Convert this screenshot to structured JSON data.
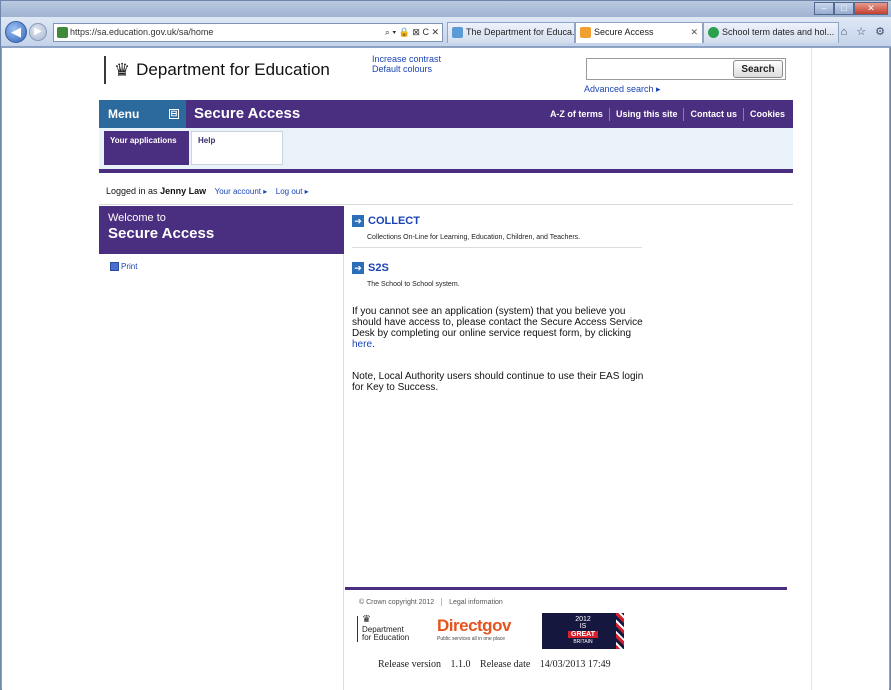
{
  "browser": {
    "address": "https://sa.education.gov.uk/sa/home",
    "address_controls": "⌕ ▾ 🔒 ⊠ C ✕",
    "tabs": [
      {
        "label": "The Department for Educa...",
        "close": "✕"
      },
      {
        "label": "Secure Access",
        "close": "✕"
      },
      {
        "label": "School term dates and hol...",
        "close": ""
      }
    ],
    "toolbar_icons": "⌂ ☆ ⚙"
  },
  "header": {
    "department": "Department for Education",
    "crest": "♛",
    "increase_contrast": "Increase contrast",
    "default_colours": "Default colours",
    "search_button": "Search",
    "search_value": "",
    "advanced_search": "Advanced search ▸"
  },
  "navbar": {
    "menu": "Menu",
    "menu_toggle": "⊟",
    "section_title": "Secure Access",
    "links": [
      "A-Z of terms",
      "Using this site",
      "Contact us",
      "Cookies"
    ]
  },
  "tabs": {
    "your_applications": "Your applications",
    "help": "Help"
  },
  "login": {
    "prefix": "Logged in as",
    "user": "Jenny Law",
    "account": "Your account ▸",
    "logout": "Log out ▸"
  },
  "sidebar": {
    "welcome_line1": "Welcome to",
    "welcome_line2": "Secure Access",
    "print": "Print"
  },
  "apps": [
    {
      "name": "COLLECT",
      "description": "Collections On-Line for Learning, Education, Children, and Teachers."
    },
    {
      "name": "S2S",
      "description": "The School to School system."
    }
  ],
  "content": {
    "para1": "If you cannot see an application (system) that you believe you should have access to, please contact the Secure Access Service Desk by completing our online service request form, by clicking ",
    "para1_link": "here",
    "para1_end": ".",
    "para2": "Note, Local Authority users should continue to use their EAS login for Key to Success."
  },
  "footer": {
    "copyright": "© Crown copyright 2012",
    "legal": "Legal information",
    "dfe_line1": "Department",
    "dfe_line2": "for Education",
    "dfe_crest": "♛",
    "directgov": "Directgov",
    "directgov_tag": "Public services all in one place",
    "gb_year": "2012",
    "gb_is": "IS",
    "gb_great": "GREAT",
    "gb_britain": "BRITAIN",
    "release_version_label": "Release version",
    "release_version": "1.1.0",
    "release_date_label": "Release date",
    "release_date": "14/03/2013 17:49"
  },
  "colors": {
    "brand_purple": "#4a2e7f",
    "menu_blue": "#2c6a9d",
    "link_blue": "#1a44b4",
    "directgov_orange": "#e5541e"
  }
}
